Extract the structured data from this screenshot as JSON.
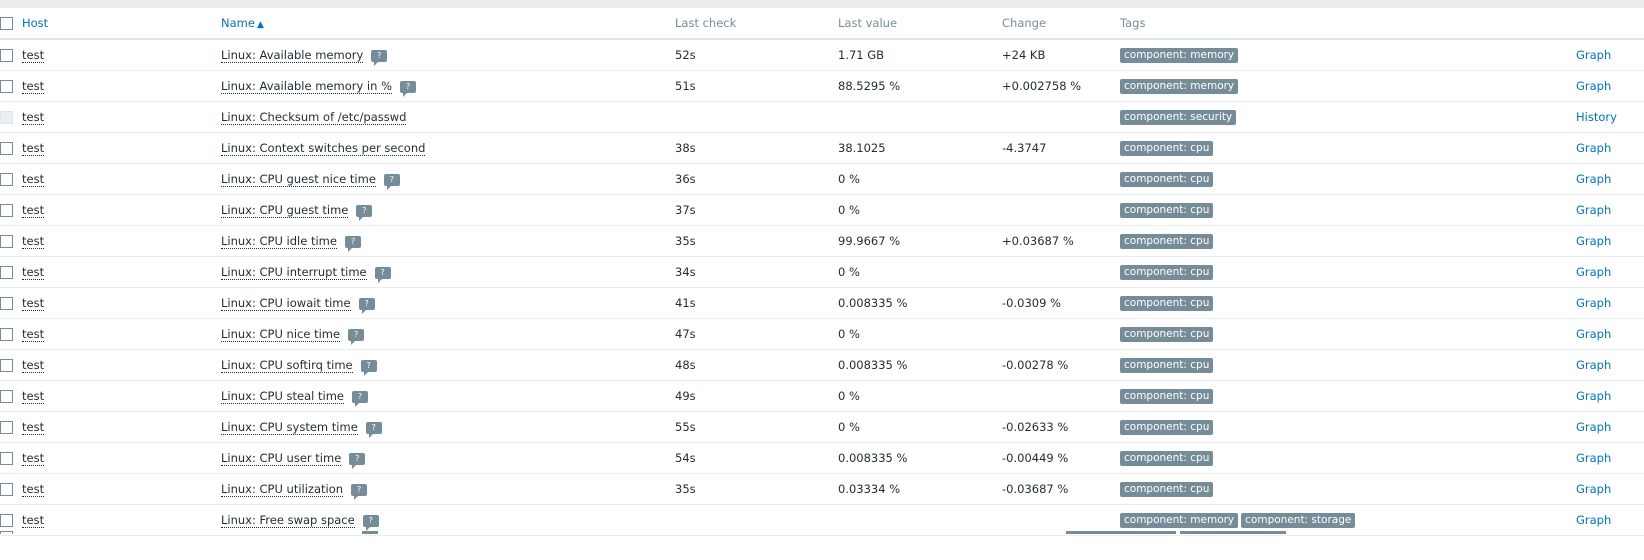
{
  "table": {
    "headers": {
      "host": "Host",
      "name": "Name",
      "sort_arrow": "▲",
      "last_check": "Last check",
      "last_value": "Last value",
      "change": "Change",
      "tags": "Tags"
    },
    "rows": [
      {
        "host": "test",
        "name": "Linux: Available memory",
        "hint": true,
        "last_check": "52s",
        "last_value": "1.71 GB",
        "change": "+24 KB",
        "tags": [
          "component: memory"
        ],
        "action": "Graph",
        "disabled": false
      },
      {
        "host": "test",
        "name": "Linux: Available memory in %",
        "hint": true,
        "last_check": "51s",
        "last_value": "88.5295 %",
        "change": "+0.002758 %",
        "tags": [
          "component: memory"
        ],
        "action": "Graph",
        "disabled": false
      },
      {
        "host": "test",
        "name": "Linux: Checksum of /etc/passwd",
        "hint": false,
        "last_check": "",
        "last_value": "",
        "change": "",
        "tags": [
          "component: security"
        ],
        "action": "History",
        "disabled": true
      },
      {
        "host": "test",
        "name": "Linux: Context switches per second",
        "hint": false,
        "last_check": "38s",
        "last_value": "38.1025",
        "change": "-4.3747",
        "tags": [
          "component: cpu"
        ],
        "action": "Graph",
        "disabled": false
      },
      {
        "host": "test",
        "name": "Linux: CPU guest nice time",
        "hint": true,
        "last_check": "36s",
        "last_value": "0 %",
        "change": "",
        "tags": [
          "component: cpu"
        ],
        "action": "Graph",
        "disabled": false
      },
      {
        "host": "test",
        "name": "Linux: CPU guest time",
        "hint": true,
        "last_check": "37s",
        "last_value": "0 %",
        "change": "",
        "tags": [
          "component: cpu"
        ],
        "action": "Graph",
        "disabled": false
      },
      {
        "host": "test",
        "name": "Linux: CPU idle time",
        "hint": true,
        "last_check": "35s",
        "last_value": "99.9667 %",
        "change": "+0.03687 %",
        "tags": [
          "component: cpu"
        ],
        "action": "Graph",
        "disabled": false
      },
      {
        "host": "test",
        "name": "Linux: CPU interrupt time",
        "hint": true,
        "last_check": "34s",
        "last_value": "0 %",
        "change": "",
        "tags": [
          "component: cpu"
        ],
        "action": "Graph",
        "disabled": false
      },
      {
        "host": "test",
        "name": "Linux: CPU iowait time",
        "hint": true,
        "last_check": "41s",
        "last_value": "0.008335 %",
        "change": "-0.0309 %",
        "tags": [
          "component: cpu"
        ],
        "action": "Graph",
        "disabled": false
      },
      {
        "host": "test",
        "name": "Linux: CPU nice time",
        "hint": true,
        "last_check": "47s",
        "last_value": "0 %",
        "change": "",
        "tags": [
          "component: cpu"
        ],
        "action": "Graph",
        "disabled": false
      },
      {
        "host": "test",
        "name": "Linux: CPU softirq time",
        "hint": true,
        "last_check": "48s",
        "last_value": "0.008335 %",
        "change": "-0.00278 %",
        "tags": [
          "component: cpu"
        ],
        "action": "Graph",
        "disabled": false
      },
      {
        "host": "test",
        "name": "Linux: CPU steal time",
        "hint": true,
        "last_check": "49s",
        "last_value": "0 %",
        "change": "",
        "tags": [
          "component: cpu"
        ],
        "action": "Graph",
        "disabled": false
      },
      {
        "host": "test",
        "name": "Linux: CPU system time",
        "hint": true,
        "last_check": "55s",
        "last_value": "0 %",
        "change": "-0.02633 %",
        "tags": [
          "component: cpu"
        ],
        "action": "Graph",
        "disabled": false
      },
      {
        "host": "test",
        "name": "Linux: CPU user time",
        "hint": true,
        "last_check": "54s",
        "last_value": "0.008335 %",
        "change": "-0.00449 %",
        "tags": [
          "component: cpu"
        ],
        "action": "Graph",
        "disabled": false
      },
      {
        "host": "test",
        "name": "Linux: CPU utilization",
        "hint": true,
        "last_check": "35s",
        "last_value": "0.03334 %",
        "change": "-0.03687 %",
        "tags": [
          "component: cpu"
        ],
        "action": "Graph",
        "disabled": false
      },
      {
        "host": "test",
        "name": "Linux: Free swap space",
        "hint": true,
        "last_check": "",
        "last_value": "",
        "change": "",
        "tags": [
          "component: memory",
          "component: storage"
        ],
        "action": "Graph",
        "disabled": false
      }
    ]
  },
  "icons": {
    "hint": "?"
  },
  "colors": {
    "link": "#0275b8",
    "tag_bg": "#768d99",
    "header_text": "#768d99"
  }
}
